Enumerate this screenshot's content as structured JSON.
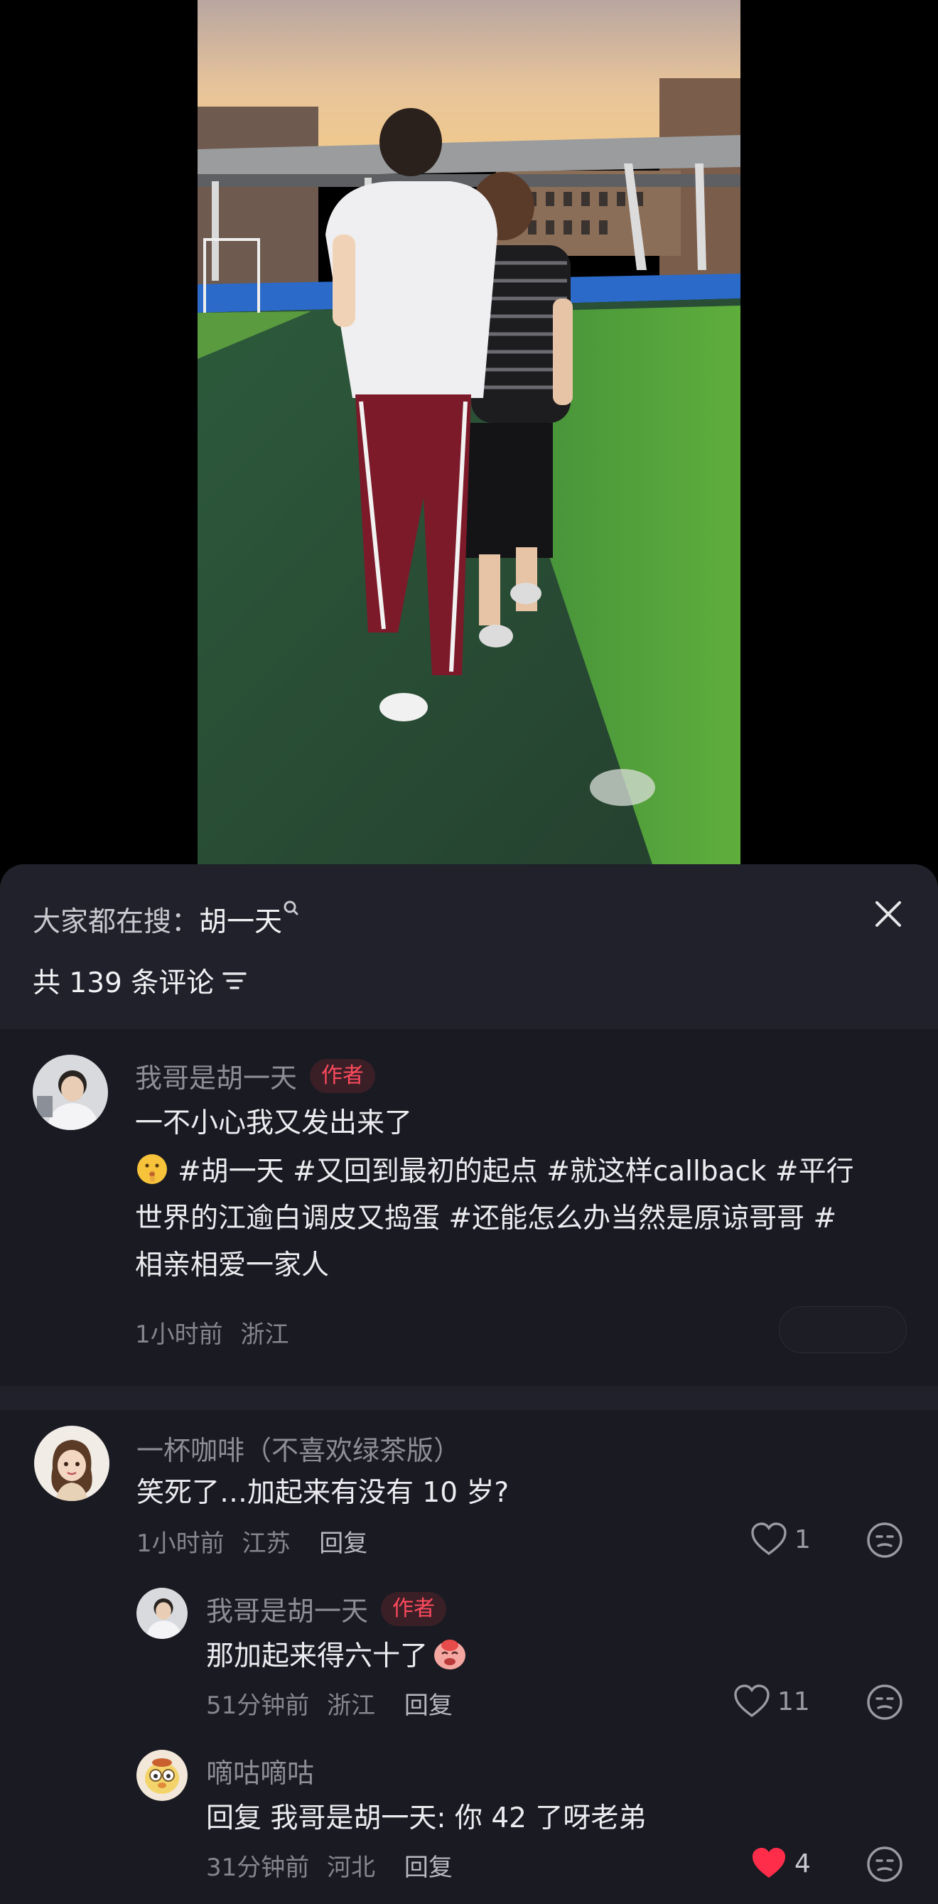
{
  "search_bar": {
    "prefix": "大家都在搜：",
    "query": "胡一天"
  },
  "comments_header": {
    "count_text": "共 139 条评论"
  },
  "pinned_comment": {
    "username": "我哥是胡一天",
    "badge": "作者",
    "line1": "一不小心我又发出来了",
    "line2": "#胡一天 #又回到最初的起点 #就这样callback #平行",
    "line3": "世界的江逾白调皮又捣蛋 #还能怎么办当然是原谅哥哥 #",
    "line4": "相亲相爱一家人",
    "emoji_name": "shushing-face-emoji",
    "time": "1小时前",
    "location": "浙江"
  },
  "comments": [
    {
      "username": "一杯咖啡（不喜欢绿茶版）",
      "text": "笑死了…加起来有没有 10 岁?",
      "time": "1小时前",
      "location": "江苏",
      "reply_label": "回复",
      "likes": "1",
      "liked": false
    },
    {
      "username": "我哥是胡一天",
      "badge": "作者",
      "text": "那加起来得六十了",
      "emoji_name": "laughing-sticker-emoji",
      "time": "51分钟前",
      "location": "浙江",
      "reply_label": "回复",
      "likes": "11",
      "liked": false
    },
    {
      "username": "嘀咕嘀咕",
      "text": "回复 我哥是胡一天: 你 42 了呀老弟",
      "time": "31分钟前",
      "location": "河北",
      "reply_label": "回复",
      "likes": "4",
      "liked": true
    }
  ],
  "colors": {
    "sheet_bg": "#1a1a22",
    "header_bg": "#20212a",
    "author_badge": "#ff4a5e",
    "liked_heart": "#ff2d4a"
  }
}
